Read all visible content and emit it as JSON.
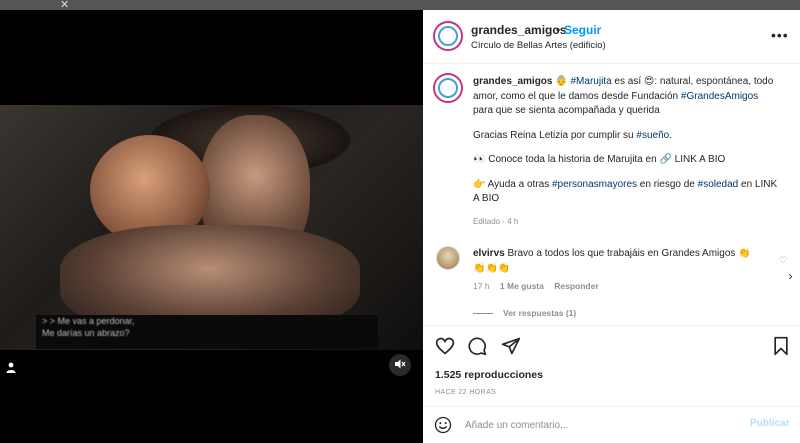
{
  "header": {
    "username": "grandes_amigos",
    "separator": "•",
    "follow_label": "Seguir",
    "location": "Círculo de Bellas Artes (edificio)",
    "more_label": "•••"
  },
  "media": {
    "subtitle_line1": "> > Me vas a perdonar,",
    "subtitle_line2": "Me darías un abrazo?",
    "user_tag_icon": "person-icon",
    "mute_icon": "speaker-muted-icon"
  },
  "caption": {
    "username": "grandes_amigos",
    "p1_emoji1": "👵",
    "p1_tag1": "#Marujita",
    "p1_mid": " es así ",
    "p1_emoji2": "😍",
    "p1_text2": ": natural, espontánea, todo amor, como el que le damos desde Fundación ",
    "p1_tag2": "#GrandesAmigos",
    "p1_text3": " para que se sienta acompañada y querida",
    "p2_text": "Gracias Reina Letizia por cumplir su ",
    "p2_tag": "#sueño",
    "p2_end": ".",
    "p3_emoji": "👀",
    "p3_text": "Conoce toda la historia de Marujita en 🔗 LINK A BIO",
    "p4_emoji": "👉",
    "p4_text1": " Ayuda a otras ",
    "p4_tag1": "#personasmayores",
    "p4_text2": " en riesgo de ",
    "p4_tag2": "#soledad",
    "p4_text3": " en LINK A BIO",
    "edited": "Editado · 4 h"
  },
  "comment": {
    "username": "elvirvs",
    "text": "Bravo a todos los que trabajáis en Grandes Amigos 👏👏👏👏",
    "time": "17 h",
    "likes": "1 Me gusta",
    "reply": "Responder",
    "view_replies": "Ver respuestas (1)"
  },
  "actions": {
    "views": "1.525 reproducciones",
    "posted": "HACE 22 HORAS"
  },
  "composer": {
    "placeholder": "Añade un comentario...",
    "publish": "Publicar"
  },
  "colors": {
    "link": "#0095f6",
    "hashtag": "#00376b",
    "muted": "#8e8e8e",
    "text": "#262626"
  }
}
